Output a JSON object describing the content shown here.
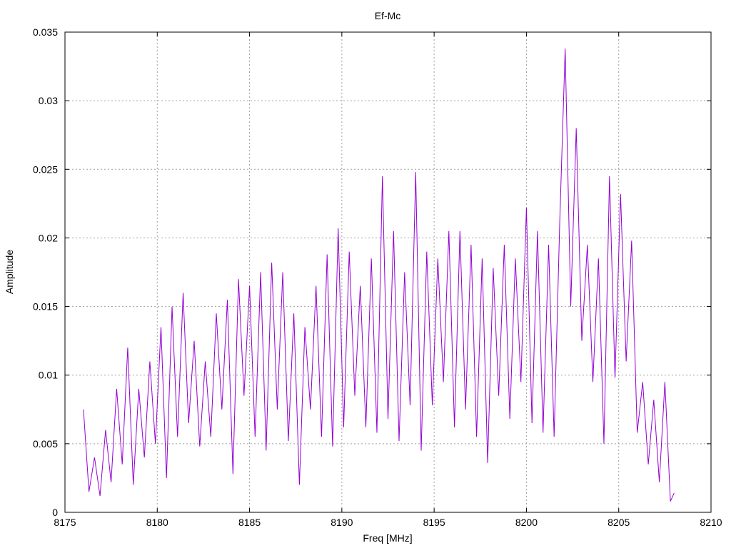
{
  "chart_data": {
    "type": "line",
    "title": "Ef-Mc",
    "xlabel": "Freq [MHz]",
    "ylabel": "Amplitude",
    "xlim": [
      8175,
      8210
    ],
    "ylim": [
      0,
      0.035
    ],
    "x_ticks": [
      8175,
      8180,
      8185,
      8190,
      8195,
      8200,
      8205,
      8210
    ],
    "x_tick_labels": [
      "8175",
      "8180",
      "8185",
      "8190",
      "8195",
      "8200",
      "8205",
      "8210"
    ],
    "y_ticks": [
      0,
      0.005,
      0.01,
      0.015,
      0.02,
      0.025,
      0.03,
      0.035
    ],
    "y_tick_labels": [
      "0",
      "0.005",
      "0.01",
      "0.015",
      "0.02",
      "0.025",
      "0.03",
      "0.035"
    ],
    "grid": true,
    "legend": "none",
    "series": [
      {
        "color": "#9400d3",
        "x": [
          8176.0,
          8176.3,
          8176.6,
          8176.9,
          8177.2,
          8177.5,
          8177.8,
          8178.1,
          8178.4,
          8178.7,
          8179.0,
          8179.3,
          8179.6,
          8179.9,
          8180.2,
          8180.5,
          8180.8,
          8181.1,
          8181.4,
          8181.7,
          8182.0,
          8182.3,
          8182.6,
          8182.9,
          8183.2,
          8183.5,
          8183.8,
          8184.1,
          8184.4,
          8184.7,
          8185.0,
          8185.3,
          8185.6,
          8185.9,
          8186.2,
          8186.5,
          8186.8,
          8187.1,
          8187.4,
          8187.7,
          8188.0,
          8188.3,
          8188.6,
          8188.9,
          8189.2,
          8189.5,
          8189.8,
          8190.1,
          8190.4,
          8190.7,
          8191.0,
          8191.3,
          8191.6,
          8191.9,
          8192.2,
          8192.5,
          8192.8,
          8193.1,
          8193.4,
          8193.7,
          8194.0,
          8194.3,
          8194.6,
          8194.9,
          8195.2,
          8195.5,
          8195.8,
          8196.1,
          8196.4,
          8196.7,
          8197.0,
          8197.3,
          8197.6,
          8197.9,
          8198.2,
          8198.5,
          8198.8,
          8199.1,
          8199.4,
          8199.7,
          8200.0,
          8200.3,
          8200.6,
          8200.9,
          8201.2,
          8201.5,
          8201.8,
          8202.1,
          8202.4,
          8202.7,
          8203.0,
          8203.3,
          8203.6,
          8203.9,
          8204.2,
          8204.5,
          8204.8,
          8205.1,
          8205.4,
          8205.7,
          8206.0,
          8206.3,
          8206.6,
          8206.9,
          8207.2,
          8207.5,
          8207.8,
          8208.0
        ],
        "y": [
          0.0075,
          0.0015,
          0.004,
          0.0012,
          0.006,
          0.0022,
          0.009,
          0.0035,
          0.012,
          0.002,
          0.009,
          0.004,
          0.011,
          0.005,
          0.0135,
          0.0025,
          0.015,
          0.0055,
          0.016,
          0.0065,
          0.0125,
          0.0048,
          0.011,
          0.0055,
          0.0145,
          0.0075,
          0.0155,
          0.0028,
          0.017,
          0.0085,
          0.0165,
          0.0055,
          0.0175,
          0.0045,
          0.0182,
          0.0075,
          0.0175,
          0.0052,
          0.0145,
          0.002,
          0.0135,
          0.0075,
          0.0165,
          0.0055,
          0.0188,
          0.0048,
          0.0207,
          0.0062,
          0.019,
          0.0085,
          0.0165,
          0.0062,
          0.0185,
          0.0058,
          0.0245,
          0.0068,
          0.0205,
          0.0052,
          0.0175,
          0.0078,
          0.0248,
          0.0045,
          0.019,
          0.0078,
          0.0185,
          0.0095,
          0.0205,
          0.0062,
          0.0205,
          0.0075,
          0.0195,
          0.0055,
          0.0185,
          0.0036,
          0.0178,
          0.0085,
          0.0195,
          0.0068,
          0.0185,
          0.0095,
          0.0222,
          0.0065,
          0.0205,
          0.0058,
          0.0195,
          0.0055,
          0.021,
          0.0338,
          0.015,
          0.028,
          0.0125,
          0.0195,
          0.0095,
          0.0185,
          0.005,
          0.0245,
          0.0098,
          0.0232,
          0.011,
          0.0198,
          0.0058,
          0.0095,
          0.0035,
          0.0082,
          0.0022,
          0.0095,
          0.0008,
          0.0014
        ]
      }
    ]
  }
}
